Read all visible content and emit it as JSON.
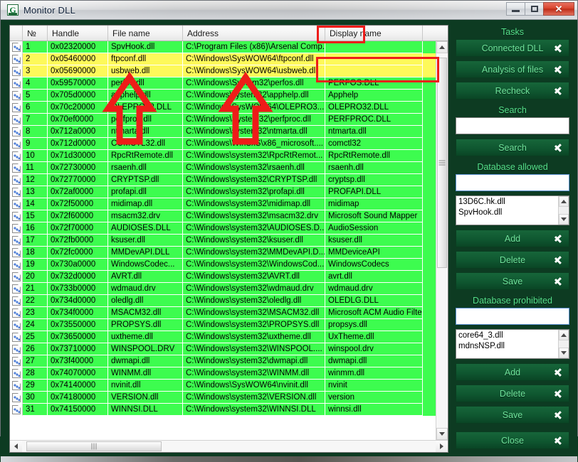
{
  "window": {
    "title": "Monitor DLL",
    "icon": "app-icon",
    "controls": {
      "minimize": "minimize",
      "maximize": "maximize",
      "close": "✕"
    }
  },
  "table": {
    "columns": [
      {
        "key": "icon",
        "label": ""
      },
      {
        "key": "num",
        "label": "№"
      },
      {
        "key": "handle",
        "label": "Handle"
      },
      {
        "key": "file",
        "label": "File name"
      },
      {
        "key": "address",
        "label": "Address"
      },
      {
        "key": "display",
        "label": "Display name"
      }
    ],
    "rows": [
      {
        "num": "1",
        "handle": "0x02320000",
        "file": "SpvHook.dll",
        "address": "C:\\Program Files (x86)\\Arsenal Comp...",
        "display": "",
        "state": "allowed"
      },
      {
        "num": "2",
        "handle": "0x05460000",
        "file": "ftpconf.dll",
        "address": "C:\\Windows\\SysWOW64\\ftpconf.dll",
        "display": "",
        "state": "flagged"
      },
      {
        "num": "3",
        "handle": "0x05690000",
        "file": "usbweb.dll",
        "address": "C:\\Windows\\SysWOW64\\usbweb.dll",
        "display": "",
        "state": "flagged"
      },
      {
        "num": "4",
        "handle": "0x59570000",
        "file": "perfos.dll",
        "address": "C:\\Windows\\System32\\perfos.dll",
        "display": "PERFOS.DLL",
        "state": "allowed"
      },
      {
        "num": "5",
        "handle": "0x705d0000",
        "file": "apphelp.dll",
        "address": "C:\\Windows\\system32\\apphelp.dll",
        "display": "Apphelp",
        "state": "allowed"
      },
      {
        "num": "6",
        "handle": "0x70c20000",
        "file": "OLEPRO32.DLL",
        "address": "C:\\Windows\\SysWOW64\\OLEPRO3...",
        "display": "OLEPRO32.DLL",
        "state": "allowed"
      },
      {
        "num": "7",
        "handle": "0x70ef0000",
        "file": "perfproc.dll",
        "address": "C:\\Windows\\System32\\perfproc.dll",
        "display": "PERFPROC.DLL",
        "state": "allowed"
      },
      {
        "num": "8",
        "handle": "0x712a0000",
        "file": "ntmarta.dll",
        "address": "C:\\Windows\\system32\\ntmarta.dll",
        "display": "ntmarta.dll",
        "state": "allowed"
      },
      {
        "num": "9",
        "handle": "0x712d0000",
        "file": "COMCTL32.dll",
        "address": "C:\\Windows\\WinSxS\\x86_microsoft....",
        "display": "comctl32",
        "state": "allowed"
      },
      {
        "num": "10",
        "handle": "0x71d30000",
        "file": "RpcRtRemote.dll",
        "address": "C:\\Windows\\system32\\RpcRtRemot...",
        "display": "RpcRtRemote.dll",
        "state": "allowed"
      },
      {
        "num": "11",
        "handle": "0x72730000",
        "file": "rsaenh.dll",
        "address": "C:\\Windows\\system32\\rsaenh.dll",
        "display": "rsaenh.dll",
        "state": "allowed"
      },
      {
        "num": "12",
        "handle": "0x72770000",
        "file": "CRYPTSP.dll",
        "address": "C:\\Windows\\system32\\CRYPTSP.dll",
        "display": "cryptsp.dll",
        "state": "allowed"
      },
      {
        "num": "13",
        "handle": "0x72af0000",
        "file": "profapi.dll",
        "address": "C:\\Windows\\system32\\profapi.dll",
        "display": "PROFAPI.DLL",
        "state": "allowed"
      },
      {
        "num": "14",
        "handle": "0x72f50000",
        "file": "midimap.dll",
        "address": "C:\\Windows\\system32\\midimap.dll",
        "display": "midimap",
        "state": "allowed"
      },
      {
        "num": "15",
        "handle": "0x72f60000",
        "file": "msacm32.drv",
        "address": "C:\\Windows\\system32\\msacm32.drv",
        "display": "Microsoft Sound Mapper",
        "state": "allowed"
      },
      {
        "num": "16",
        "handle": "0x72f70000",
        "file": "AUDIOSES.DLL",
        "address": "C:\\Windows\\system32\\AUDIOSES.D...",
        "display": "AudioSession",
        "state": "allowed"
      },
      {
        "num": "17",
        "handle": "0x72fb0000",
        "file": "ksuser.dll",
        "address": "C:\\Windows\\system32\\ksuser.dll",
        "display": "ksuser.dll",
        "state": "allowed"
      },
      {
        "num": "18",
        "handle": "0x72fc0000",
        "file": "MMDevAPI.DLL",
        "address": "C:\\Windows\\system32\\MMDevAPI.D...",
        "display": "MMDeviceAPI",
        "state": "allowed"
      },
      {
        "num": "19",
        "handle": "0x730a0000",
        "file": "WindowsCodec...",
        "address": "C:\\Windows\\system32\\WindowsCod...",
        "display": "WindowsCodecs",
        "state": "allowed"
      },
      {
        "num": "20",
        "handle": "0x732d0000",
        "file": "AVRT.dll",
        "address": "C:\\Windows\\system32\\AVRT.dll",
        "display": "avrt.dll",
        "state": "allowed"
      },
      {
        "num": "21",
        "handle": "0x733b0000",
        "file": "wdmaud.drv",
        "address": "C:\\Windows\\system32\\wdmaud.drv",
        "display": "wdmaud.drv",
        "state": "allowed"
      },
      {
        "num": "22",
        "handle": "0x734d0000",
        "file": "oledlg.dll",
        "address": "C:\\Windows\\system32\\oledlg.dll",
        "display": "OLEDLG.DLL",
        "state": "allowed"
      },
      {
        "num": "23",
        "handle": "0x734f0000",
        "file": "MSACM32.dll",
        "address": "C:\\Windows\\system32\\MSACM32.dll",
        "display": "Microsoft ACM Audio Filter",
        "state": "allowed"
      },
      {
        "num": "24",
        "handle": "0x73550000",
        "file": "PROPSYS.dll",
        "address": "C:\\Windows\\system32\\PROPSYS.dll",
        "display": "propsys.dll",
        "state": "allowed"
      },
      {
        "num": "25",
        "handle": "0x73650000",
        "file": "uxtheme.dll",
        "address": "C:\\Windows\\system32\\uxtheme.dll",
        "display": "UxTheme.dll",
        "state": "allowed"
      },
      {
        "num": "26",
        "handle": "0x73710000",
        "file": "WINSPOOL.DRV",
        "address": "C:\\Windows\\system32\\WINSPOOL....",
        "display": "winspool.drv",
        "state": "allowed"
      },
      {
        "num": "27",
        "handle": "0x73f40000",
        "file": "dwmapi.dll",
        "address": "C:\\Windows\\system32\\dwmapi.dll",
        "display": "dwmapi.dll",
        "state": "allowed"
      },
      {
        "num": "28",
        "handle": "0x74070000",
        "file": "WINMM.dll",
        "address": "C:\\Windows\\system32\\WINMM.dll",
        "display": "winmm.dll",
        "state": "allowed"
      },
      {
        "num": "29",
        "handle": "0x74140000",
        "file": "nvinit.dll",
        "address": "C:\\Windows\\SysWOW64\\nvinit.dll",
        "display": "nvinit",
        "state": "allowed"
      },
      {
        "num": "30",
        "handle": "0x74180000",
        "file": "VERSION.dll",
        "address": "C:\\Windows\\system32\\VERSION.dll",
        "display": "version",
        "state": "allowed"
      },
      {
        "num": "31",
        "handle": "0x74150000",
        "file": "WINNSI.DLL",
        "address": "C:\\Windows\\system32\\WINNSI.DLL",
        "display": "winnsi.dll",
        "state": "allowed"
      }
    ]
  },
  "sidebar": {
    "tasks_title": "Tasks",
    "buttons": {
      "connected_dll": "Connected DLL",
      "analysis_of_files": "Analysis of files",
      "recheck": "Recheck",
      "search": "Search",
      "add": "Add",
      "delete": "Delete",
      "save": "Save",
      "close": "Close"
    },
    "search": {
      "title": "Search",
      "value": "",
      "placeholder": ""
    },
    "allowed": {
      "title": "Database allowed",
      "input_value": "",
      "items": [
        "13D6C.hk.dll",
        "SpvHook.dll"
      ]
    },
    "prohibited": {
      "title": "Database prohibited",
      "input_value": "",
      "items": [
        "core64_3.dll",
        "mdnsNSP.dll"
      ]
    }
  },
  "annotations": {
    "header_highlight": "Display name",
    "cells_highlight": "rows 2-3 display name empty",
    "arrow_1": "points at File name column rows 4-9",
    "arrow_2": "points at Address column rows 4-9"
  },
  "colors": {
    "allowed_row": "#3dfc4f",
    "flagged_row": "#fdf95a",
    "panel_bg": "#0d3b22",
    "button_text": "#6fe39b",
    "annotation": "#ee1c19"
  }
}
